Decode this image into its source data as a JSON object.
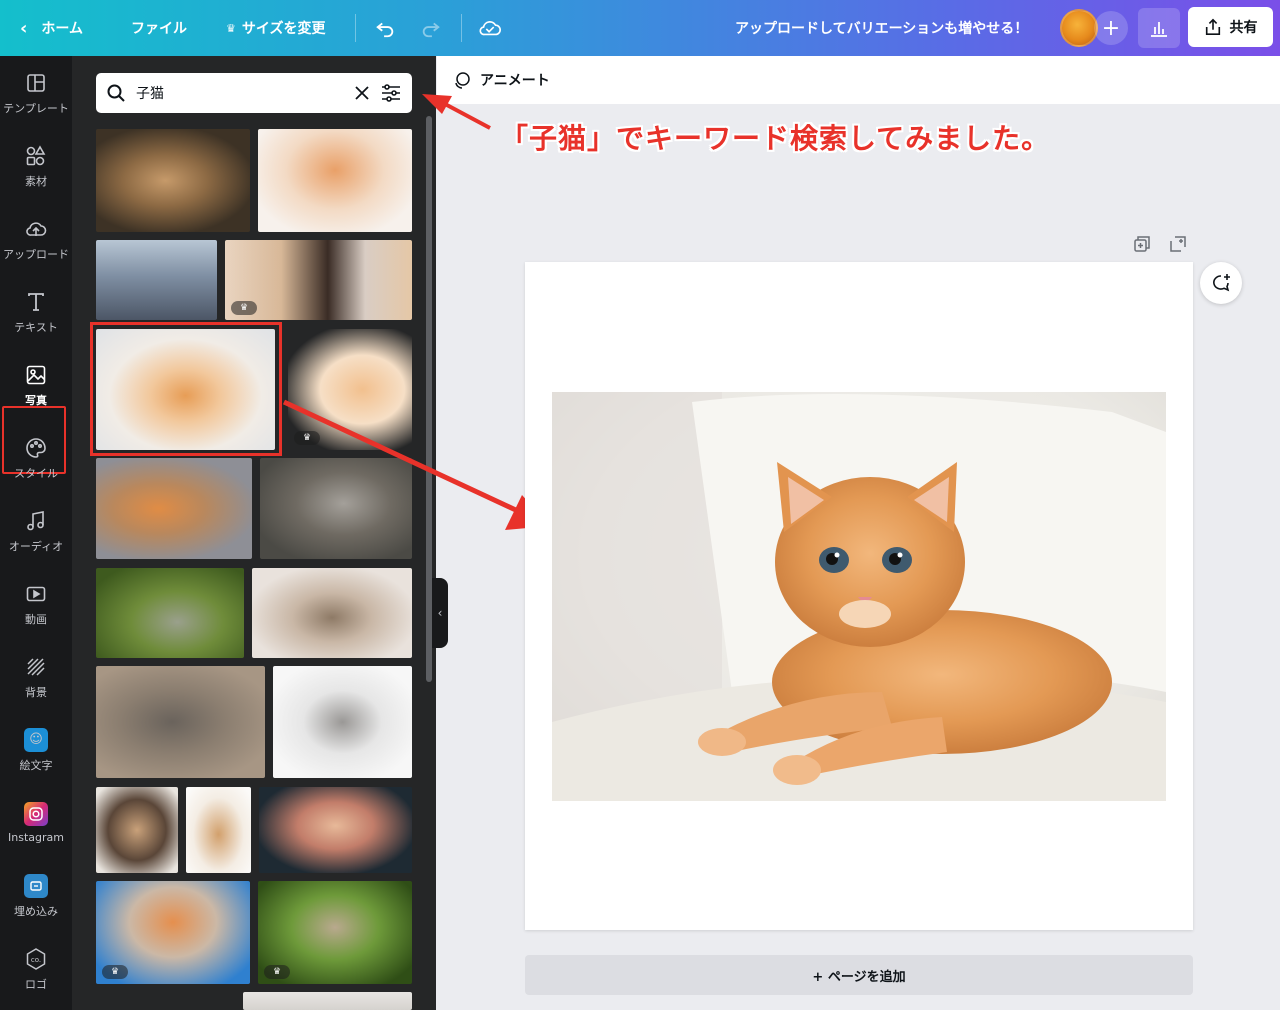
{
  "topbar": {
    "home_label": "ホーム",
    "file_label": "ファイル",
    "resize_label": "サイズを変更",
    "upload_cta": "アップロードしてバリエーションも増やせる！",
    "share_label": "共有",
    "colors": {
      "gradient_start": "#14bfcc",
      "gradient_end": "#7a4fe8"
    }
  },
  "rail": {
    "items": [
      {
        "label": "テンプレート",
        "icon": "layout-icon"
      },
      {
        "label": "素材",
        "icon": "shapes-icon"
      },
      {
        "label": "アップロード",
        "icon": "cloud-upload-icon"
      },
      {
        "label": "テキスト",
        "icon": "text-icon"
      },
      {
        "label": "写真",
        "icon": "photo-icon"
      },
      {
        "label": "スタイル",
        "icon": "palette-icon"
      },
      {
        "label": "オーディオ",
        "icon": "music-icon"
      },
      {
        "label": "動画",
        "icon": "video-icon"
      },
      {
        "label": "背景",
        "icon": "background-icon"
      },
      {
        "label": "絵文字",
        "icon": "emoji-icon"
      },
      {
        "label": "Instagram",
        "icon": "instagram-icon"
      },
      {
        "label": "埋め込み",
        "icon": "embed-icon"
      },
      {
        "label": "ロゴ",
        "icon": "logo-icon"
      }
    ]
  },
  "search": {
    "value": "子猫"
  },
  "canvas": {
    "animate_label": "アニメート",
    "add_page_label": "+ ページを追加"
  },
  "annotation": {
    "callout": "「子猫」でキーワード検索してみました。",
    "color": "#e8322a"
  }
}
